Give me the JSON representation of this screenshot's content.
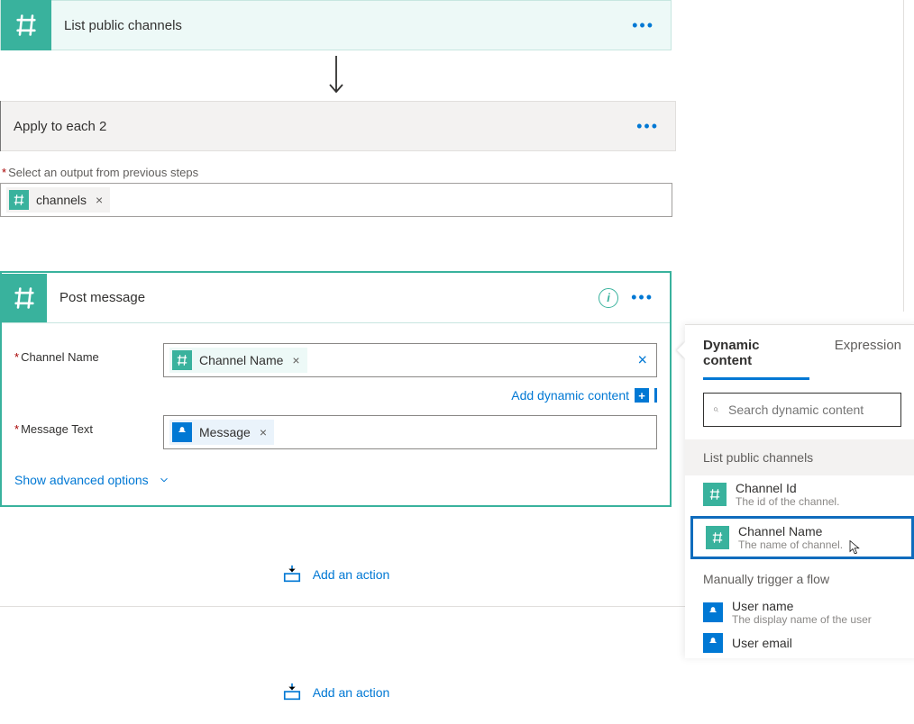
{
  "step_list_channels": {
    "title": "List public channels"
  },
  "step_apply": {
    "title": "Apply to each 2",
    "select_label": "Select an output from previous steps",
    "token": "channels"
  },
  "step_post": {
    "title": "Post message",
    "field_channel_label": "Channel Name",
    "channel_token": "Channel Name",
    "dynamic_link": "Add dynamic content",
    "field_message_label": "Message Text",
    "message_token": "Message",
    "advanced_link": "Show advanced options"
  },
  "add_action": "Add an action",
  "dc_panel": {
    "tab_dynamic": "Dynamic content",
    "tab_expression": "Expression",
    "search_placeholder": "Search dynamic content",
    "section_lpc": "List public channels",
    "item_channel_id": {
      "title": "Channel Id",
      "desc": "The id of the channel."
    },
    "item_channel_name": {
      "title": "Channel Name",
      "desc": "The name of channel."
    },
    "section_manual": "Manually trigger a flow",
    "item_user_name": {
      "title": "User name",
      "desc": "The display name of the user"
    },
    "item_user_email": {
      "title": "User email"
    }
  }
}
